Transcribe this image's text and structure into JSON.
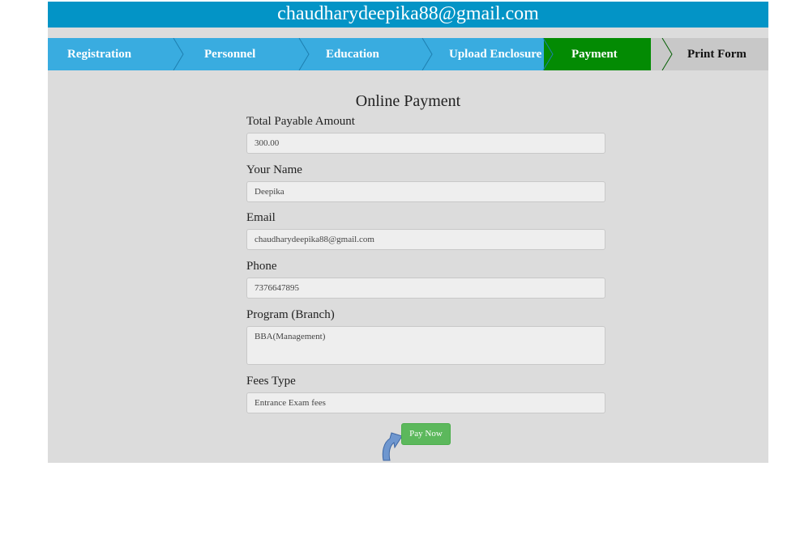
{
  "header": {
    "email": "chaudharydeepika88@gmail.com"
  },
  "steps": [
    {
      "label": "Registration",
      "state": "done"
    },
    {
      "label": "Personnel",
      "state": "done"
    },
    {
      "label": "Education",
      "state": "done"
    },
    {
      "label": "Upload Enclosure",
      "state": "done"
    },
    {
      "label": "Payment",
      "state": "active"
    },
    {
      "label": "Print Form",
      "state": "pending"
    }
  ],
  "form": {
    "title": "Online Payment",
    "fields": [
      {
        "label": "Total Payable Amount",
        "value": "300.00"
      },
      {
        "label": "Your Name",
        "value": "Deepika"
      },
      {
        "label": "Email",
        "value": "chaudharydeepika88@gmail.com"
      },
      {
        "label": "Phone",
        "value": "7376647895"
      },
      {
        "label": "Program (Branch)",
        "value": "BBA(Management)"
      },
      {
        "label": "Fees Type",
        "value": "Entrance Exam fees"
      }
    ],
    "submit_label": "Pay Now"
  },
  "colors": {
    "header": "#0394c6",
    "step_done": "#39ace0",
    "step_active": "#038b03",
    "step_pending": "#c8c8c8",
    "button": "#5cb85c"
  },
  "icons": {
    "pointer": "curved-arrow-icon"
  }
}
